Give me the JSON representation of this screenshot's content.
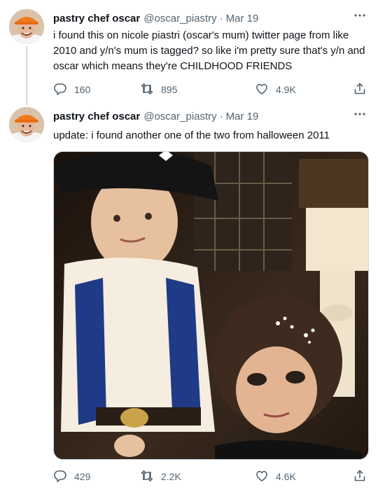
{
  "tweets": [
    {
      "author": {
        "name": "pastry chef oscar",
        "handle": "@oscar_piastry"
      },
      "separator": "·",
      "date": "Mar 19",
      "text": "i found this on nicole piastri (oscar's mum) twitter page from like 2010 and y/n's mum is tagged? so like i'm pretty sure that's y/n and oscar which means they're CHILDHOOD FRIENDS",
      "stats": {
        "replies": "160",
        "retweets": "895",
        "likes": "4.9K"
      }
    },
    {
      "author": {
        "name": "pastry chef oscar",
        "handle": "@oscar_piastry"
      },
      "separator": "·",
      "date": "Mar 19",
      "text": "update: i found another one of the two from halloween 2011",
      "stats": {
        "replies": "429",
        "retweets": "2.2K",
        "likes": "4.6K"
      }
    }
  ],
  "icons": {
    "more": "more-icon",
    "reply": "reply-icon",
    "retweet": "retweet-icon",
    "like": "heart-icon",
    "share": "share-icon"
  },
  "colors": {
    "text": "#0f1419",
    "secondary": "#536471",
    "divider": "#cfd9de"
  }
}
